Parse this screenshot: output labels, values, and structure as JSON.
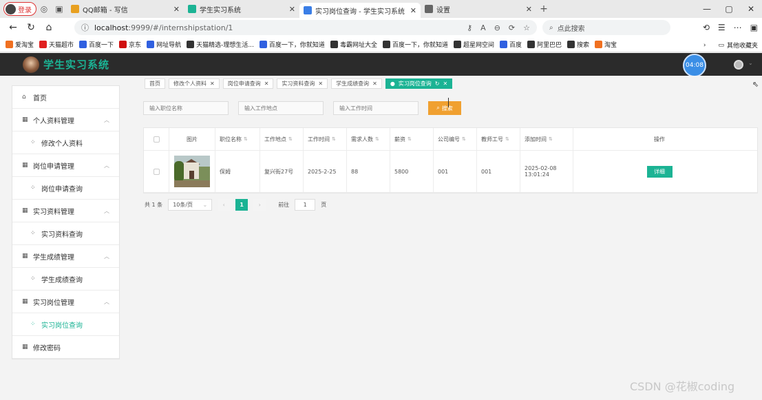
{
  "browser": {
    "profile_label": "登录",
    "tabs": [
      {
        "title": "QQ邮箱 - 写信",
        "color": "#e8a020"
      },
      {
        "title": "学生实习系统",
        "color": "#1bb394"
      },
      {
        "title": "实习岗位查询 - 学生实习系统",
        "color": "#3a7ee6",
        "active": true
      },
      {
        "title": "设置",
        "color": "#666"
      }
    ],
    "url_host": "localhost",
    "url_rest": ":9999/#/internshipstation/1",
    "search_placeholder": "点此搜索",
    "bookmarks": [
      {
        "label": "爱淘宝",
        "color": "#f07020"
      },
      {
        "label": "天猫超市",
        "color": "#e02020"
      },
      {
        "label": "百度一下",
        "color": "#3060e0"
      },
      {
        "label": "京东",
        "color": "#d01010"
      },
      {
        "label": "网址导航",
        "color": "#3060e0"
      },
      {
        "label": "天猫精选-理想生活...",
        "color": "#333"
      },
      {
        "label": "百度一下，你就知道",
        "color": "#3060e0"
      },
      {
        "label": "毒霸网址大全",
        "color": "#333"
      },
      {
        "label": "百度一下，你就知道",
        "color": "#333"
      },
      {
        "label": "超星网空间",
        "color": "#333"
      },
      {
        "label": "百度",
        "color": "#3060e0"
      },
      {
        "label": "阿里巴巴",
        "color": "#333"
      },
      {
        "label": "搜索",
        "color": "#333"
      },
      {
        "label": "淘宝",
        "color": "#f07020"
      }
    ],
    "other_bookmarks": "其他收藏夹"
  },
  "app": {
    "title": "学生实习系统",
    "timer": "04:08"
  },
  "sidebar": {
    "items": [
      {
        "label": "首页",
        "icon": "home-icon",
        "glyph": "⌂",
        "type": "top"
      },
      {
        "label": "个人资料管理",
        "icon": "grid-icon",
        "glyph": "▦",
        "type": "group"
      },
      {
        "label": "修改个人资料",
        "icon": "apps-icon",
        "glyph": "⁘",
        "type": "sub"
      },
      {
        "label": "岗位申请管理",
        "icon": "grid-icon",
        "glyph": "▦",
        "type": "group"
      },
      {
        "label": "岗位申请查询",
        "icon": "apps-icon",
        "glyph": "⁘",
        "type": "sub"
      },
      {
        "label": "实习资料管理",
        "icon": "grid-icon",
        "glyph": "▦",
        "type": "group"
      },
      {
        "label": "实习资料查询",
        "icon": "apps-icon",
        "glyph": "⁘",
        "type": "sub"
      },
      {
        "label": "学生成绩管理",
        "icon": "grid-icon",
        "glyph": "▦",
        "type": "group"
      },
      {
        "label": "学生成绩查询",
        "icon": "apps-icon",
        "glyph": "⁘",
        "type": "sub"
      },
      {
        "label": "实习岗位管理",
        "icon": "grid-icon",
        "glyph": "▦",
        "type": "group"
      },
      {
        "label": "实习岗位查询",
        "icon": "apps-icon",
        "glyph": "⁘",
        "type": "sub",
        "active": true
      },
      {
        "label": "修改密码",
        "icon": "grid-icon",
        "glyph": "▦",
        "type": "top"
      }
    ]
  },
  "tags": [
    {
      "label": "首页",
      "closable": false
    },
    {
      "label": "修改个人资料",
      "closable": true
    },
    {
      "label": "岗位申请查询",
      "closable": true
    },
    {
      "label": "实习资料查询",
      "closable": true
    },
    {
      "label": "学生成绩查询",
      "closable": true
    },
    {
      "label": "实习岗位查询",
      "closable": true,
      "active": true
    }
  ],
  "search": {
    "name_placeholder": "输入职位名称",
    "location_placeholder": "输入工作地点",
    "time_placeholder": "输入工作时间",
    "button_label": "搜索"
  },
  "table": {
    "headers": [
      "图片",
      "职位名称",
      "工作地点",
      "工作时间",
      "需求人数",
      "薪资",
      "公司编号",
      "教师工号",
      "添加时间",
      "操作"
    ],
    "rows": [
      {
        "name": "保姆",
        "location": "复兴街27号",
        "time": "2025-2-25",
        "count": "88",
        "salary": "5800",
        "company": "001",
        "teacher": "001",
        "added": "2025-02-08 13:01:24",
        "action": "详细"
      }
    ]
  },
  "pager": {
    "total": "共 1 条",
    "size": "10条/页",
    "current": "1",
    "goto_label": "前往",
    "goto_value": "1",
    "page_suffix": "页"
  },
  "watermark": "CSDN @花椒coding"
}
